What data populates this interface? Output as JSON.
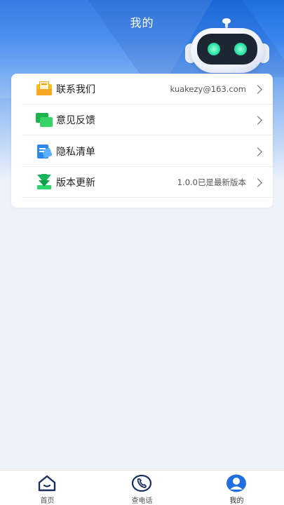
{
  "header": {
    "title": "我的"
  },
  "menu": [
    {
      "label": "联系我们",
      "value": "kuakezy@163.com",
      "icon": "mail-icon"
    },
    {
      "label": "意见反馈",
      "value": "",
      "icon": "chat-icon"
    },
    {
      "label": "隐私清单",
      "value": "",
      "icon": "document-icon"
    },
    {
      "label": "版本更新",
      "value": "1.0.0已是最新版本",
      "icon": "download-icon"
    }
  ],
  "tabbar": [
    {
      "label": "首页",
      "icon": "home-icon"
    },
    {
      "label": "查电话",
      "icon": "phone-icon"
    },
    {
      "label": "我的",
      "icon": "profile-icon",
      "active": true
    }
  ],
  "colors": {
    "brand": "#1f6fe0",
    "tab_active": "#1f6fe0",
    "tab_inactive": "#1a2f5c"
  }
}
